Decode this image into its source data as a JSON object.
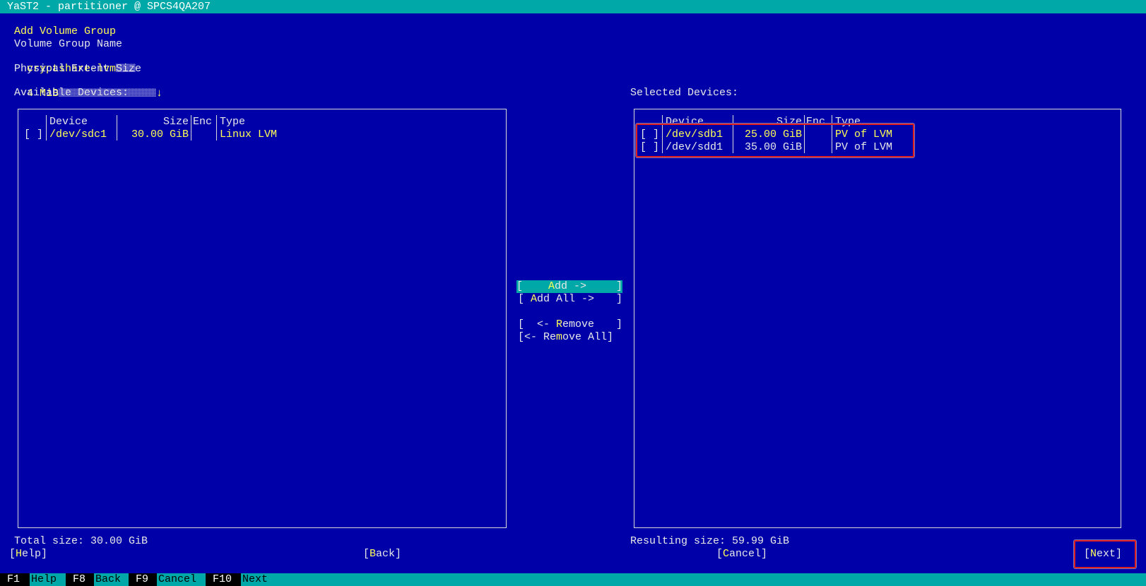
{
  "window": {
    "title": "YaST2 - partitioner @ SPCS4QA207"
  },
  "dialog": {
    "heading": "Add Volume Group",
    "vg_name_label": "Volume Group Name",
    "vg_name_value": "cryptshare-lvm",
    "pe_size_label": "Physical Extent Size",
    "pe_size_value": "4 MiB",
    "pe_size_arrow": "↓"
  },
  "available": {
    "label": "Available Devices:",
    "columns": [
      "Device",
      "Size",
      "Enc",
      "Type"
    ],
    "rows": [
      {
        "check": "[ ]",
        "device": "/dev/sdc1",
        "size": "30.00 GiB",
        "enc": "",
        "type": "Linux LVM"
      }
    ],
    "total": "Total size: 30.00 GiB"
  },
  "selected": {
    "label": "Selected Devices:",
    "columns": [
      "Device",
      "Size",
      "Enc",
      "Type"
    ],
    "rows": [
      {
        "check": "[ ]",
        "device": "/dev/sdb1",
        "size": "25.00 GiB",
        "enc": "",
        "type": "PV of LVM"
      },
      {
        "check": "[ ]",
        "device": "/dev/sdd1",
        "size": "35.00 GiB",
        "enc": "",
        "type": "PV of LVM"
      }
    ],
    "resulting": "Resulting size: 59.99 GiB"
  },
  "middle_buttons": {
    "add": {
      "open": "[",
      "pre": "    ",
      "hot": "A",
      "rest": "dd ->",
      "close": "]"
    },
    "add_all": {
      "open": "[ ",
      "hot": "A",
      "rest": "dd All ->",
      "close": "]"
    },
    "remove": {
      "open": "[  <- ",
      "hot": "R",
      "rest": "emove",
      "close": "]"
    },
    "remove_all": {
      "open": "[<- Re",
      "hot": "m",
      "rest": "ove All",
      "close": "]"
    }
  },
  "footer_buttons": {
    "help": {
      "open": "[",
      "hot": "H",
      "rest": "elp",
      "close": "]"
    },
    "back": {
      "open": "[",
      "hot": "B",
      "rest": "ack",
      "close": "]"
    },
    "cancel": {
      "open": "[",
      "hot": "C",
      "rest": "ancel",
      "close": "]"
    },
    "next": {
      "open": "[",
      "hot": "N",
      "rest": "ext",
      "close": "]"
    }
  },
  "function_keys": [
    {
      "key": "F1",
      "label": "Help"
    },
    {
      "key": "F8",
      "label": "Back"
    },
    {
      "key": "F9",
      "label": "Cancel"
    },
    {
      "key": "F10",
      "label": "Next"
    }
  ],
  "colors": {
    "background": "#0000a8",
    "titlebar": "#00a8a8",
    "highlight_text": "#ffff55",
    "annotation_red": "#e02020"
  }
}
